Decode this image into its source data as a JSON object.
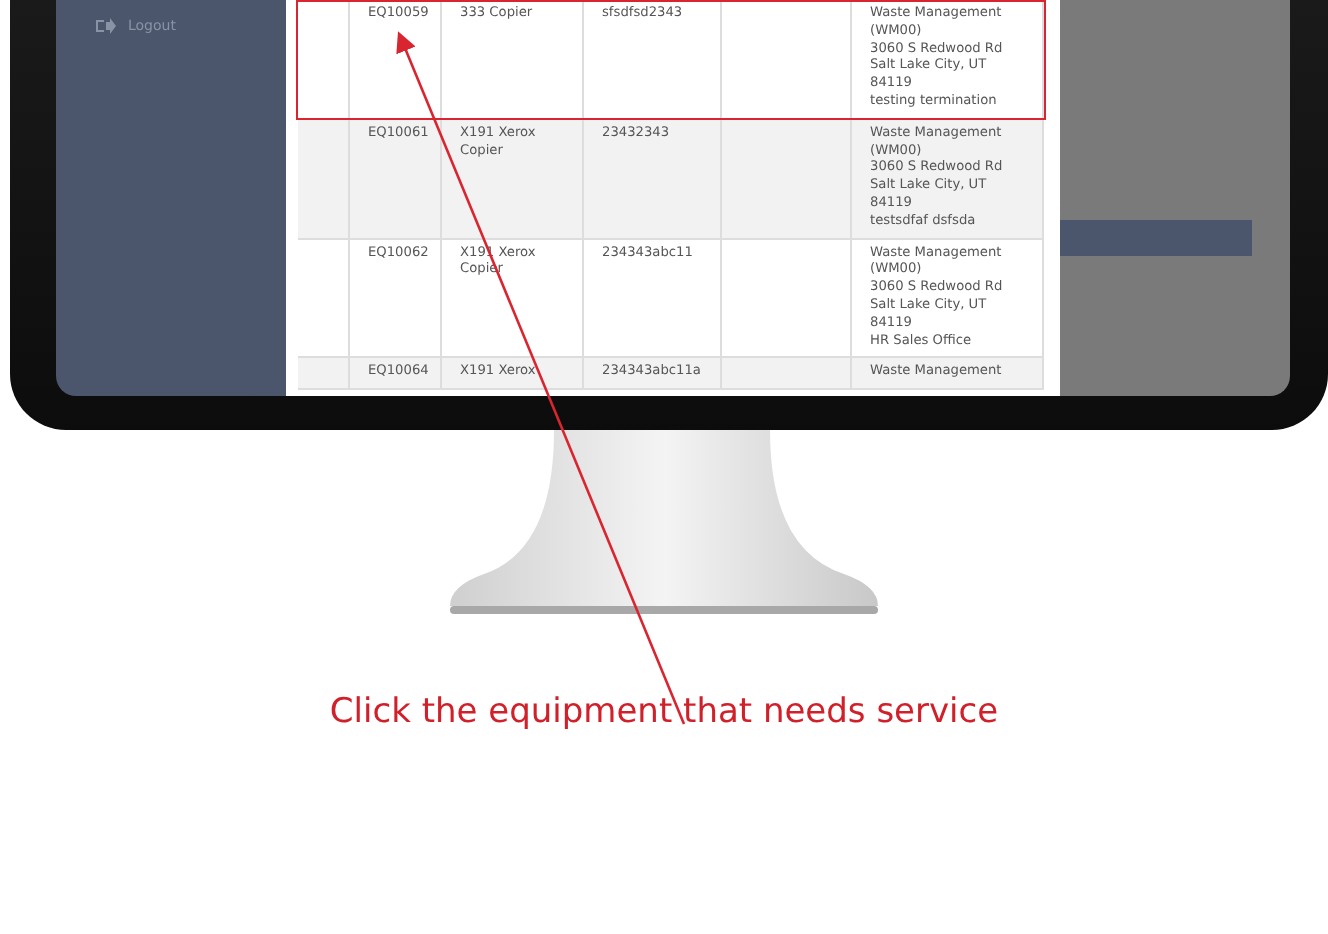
{
  "sidebar": {
    "items": [
      {
        "label": "Logout"
      }
    ]
  },
  "table": {
    "rows": [
      {
        "column_2": "EQ10059",
        "column_3": "333 Copier",
        "column_4": "sfsdfsd2343",
        "column_6": [
          "Waste Management",
          "(WM00)",
          "3060 S Redwood Rd",
          "Salt Lake City, UT",
          "84119",
          "testing termination"
        ],
        "highlighted": true
      },
      {
        "column_2": "EQ10061",
        "column_3": "X191 Xerox Copier",
        "column_4": "23432343",
        "column_6": [
          "Waste Management",
          "(WM00)",
          "3060 S Redwood Rd",
          "Salt Lake City, UT",
          "84119",
          "testsdfaf dsfsda"
        ],
        "highlighted": false
      },
      {
        "column_2": "EQ10062",
        "column_3": "X191 Xerox Copier",
        "column_4": "234343abc11",
        "column_6": [
          "Waste Management",
          "(WM00)",
          "3060 S Redwood Rd",
          "Salt Lake City, UT",
          "84119",
          "HR Sales Office"
        ],
        "highlighted": false
      },
      {
        "column_2": "EQ10064",
        "column_3": "X191 Xerox",
        "column_4": "234343abc11a",
        "column_6": [
          "Waste Management"
        ],
        "highlighted": false
      }
    ]
  },
  "instruction": "Click the equipment that needs service"
}
